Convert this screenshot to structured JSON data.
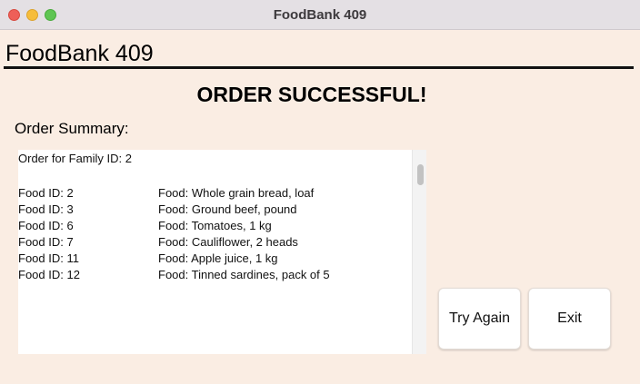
{
  "window": {
    "title": "FoodBank 409"
  },
  "header": {
    "title": "FoodBank 409"
  },
  "banner": {
    "text": "ORDER SUCCESSFUL!"
  },
  "summary": {
    "label": "Order Summary:",
    "family_line": "Order for Family ID: 2",
    "items": [
      {
        "id": "Food ID: 2",
        "food": "Food: Whole grain bread, loaf"
      },
      {
        "id": "Food ID: 3",
        "food": "Food: Ground beef, pound"
      },
      {
        "id": "Food ID: 6",
        "food": "Food: Tomatoes, 1 kg"
      },
      {
        "id": "Food ID: 7",
        "food": "Food: Cauliflower, 2 heads"
      },
      {
        "id": "Food ID: 11",
        "food": "Food: Apple juice, 1 kg"
      },
      {
        "id": "Food ID: 12",
        "food": "Food: Tinned sardines, pack of 5"
      }
    ]
  },
  "buttons": {
    "try_again": "Try Again",
    "exit": "Exit"
  },
  "colors": {
    "window_background": "#faede3",
    "titlebar_background": "#e4e0e4",
    "close_light": "#ee5f58",
    "minimize_light": "#f6bd3b",
    "maximize_light": "#5fc553"
  }
}
